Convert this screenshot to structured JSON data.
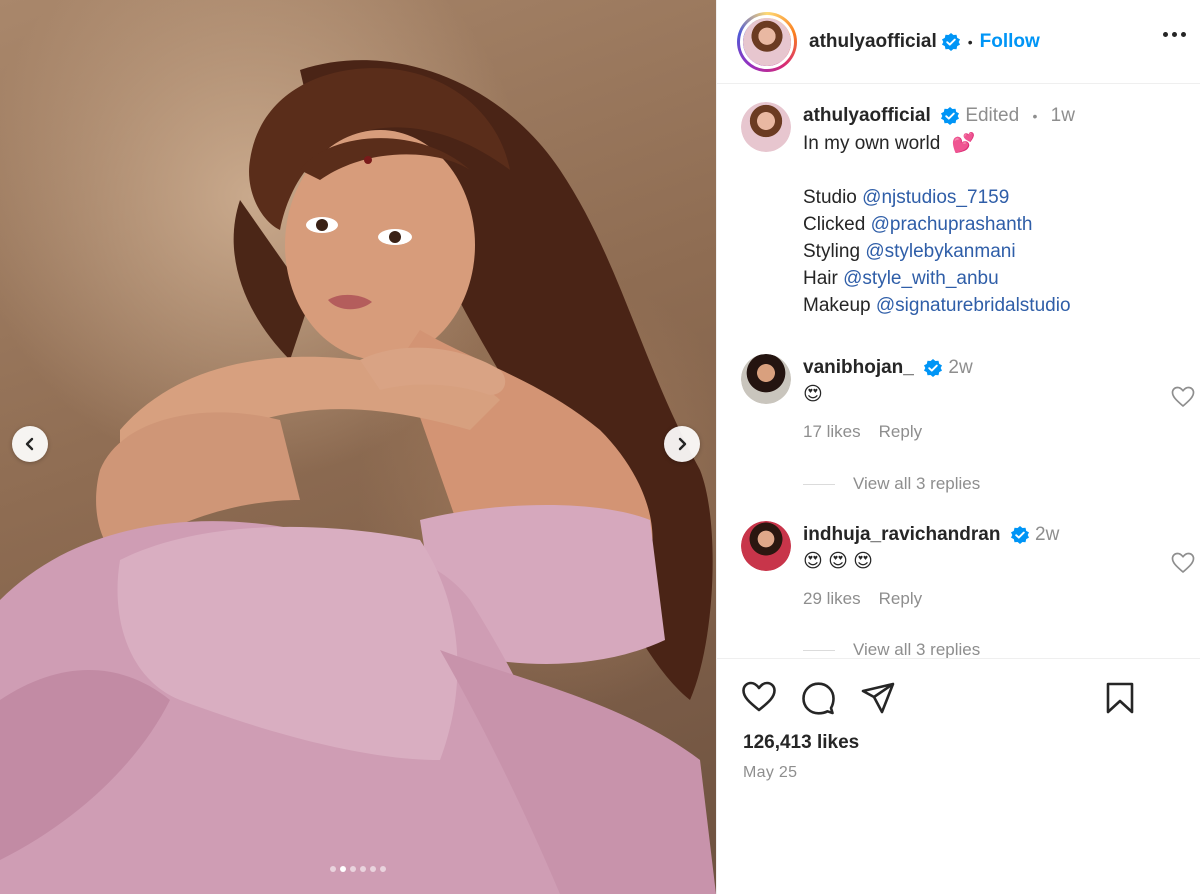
{
  "post": {
    "author": "athulyaofficial",
    "follow_label": "Follow",
    "separator": "•",
    "carousel": {
      "slide_count": 6,
      "active_index": 1
    }
  },
  "caption": {
    "username": "athulyaofficial",
    "edited": "Edited",
    "dot": "•",
    "age": "1w",
    "line1": "In my own world",
    "line1_emoji": "💕",
    "credits": [
      {
        "label": "Studio",
        "handle": "@njstudios_7159"
      },
      {
        "label": "Clicked",
        "handle": "@prachuprashanth"
      },
      {
        "label": "Styling",
        "handle": "@stylebykanmani"
      },
      {
        "label": "Hair",
        "handle": "@style_with_anbu"
      },
      {
        "label": "Makeup",
        "handle": "@signaturebridalstudio"
      }
    ]
  },
  "comments": [
    {
      "username": "vanibhojan_",
      "age": "2w",
      "text": "😍",
      "likes": "17 likes",
      "reply_label": "Reply",
      "view_replies": "View all 3 replies"
    },
    {
      "username": "indhuja_ravichandran",
      "age": "2w",
      "text": "😍 😍 😍",
      "likes": "29 likes",
      "reply_label": "Reply",
      "view_replies": "View all 3 replies"
    }
  ],
  "footer": {
    "likes": "126,413 likes",
    "date": "May 25"
  },
  "icons": {
    "like": "heart-icon",
    "comment": "comment-icon",
    "share": "paper-plane-icon",
    "save": "bookmark-icon",
    "more": "more-options-icon",
    "verified": "verified-badge-icon",
    "prev": "chevron-left-icon",
    "next": "chevron-right-icon"
  },
  "colors": {
    "accent": "#0095f6",
    "mention": "#00376b",
    "verified": "#0095f6",
    "muted": "#8e8e8e"
  }
}
